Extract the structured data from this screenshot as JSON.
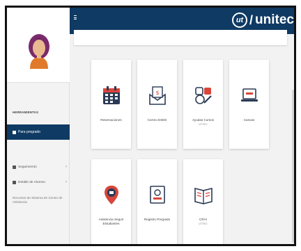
{
  "brand": {
    "logo_badge": "ut",
    "logo_text": "unitec",
    "header_color": "#0e3a63",
    "accent": "#0f3a63"
  },
  "sidebar": {
    "section_label": "HERRAMIENTAS",
    "active_item": "Para pregrado",
    "items": [
      {
        "label": "Seguimiento"
      },
      {
        "label": "Detalle de Alumno"
      }
    ],
    "link": "Recursos de Sistema de Centro de Asistencia"
  },
  "tiles": [
    {
      "label": "Reservaciones",
      "sub": "",
      "icon": "calendar-icon"
    },
    {
      "label": "Correo DSEE",
      "sub": "",
      "icon": "mail-document-icon"
    },
    {
      "label": "Ayudas Cursos",
      "sub": "UTTEC",
      "icon": "tools-icon"
    },
    {
      "label": "Canvas",
      "sub": "",
      "icon": "laptop-icon"
    },
    {
      "label": "Asistencia Seguir Estudiantes",
      "sub": "",
      "icon": "map-pin-icon"
    },
    {
      "label": "Registro Pregrado",
      "sub": "",
      "icon": "id-card-icon"
    },
    {
      "label": "CRAI",
      "sub": "UTTEC",
      "icon": "open-book-icon"
    }
  ]
}
